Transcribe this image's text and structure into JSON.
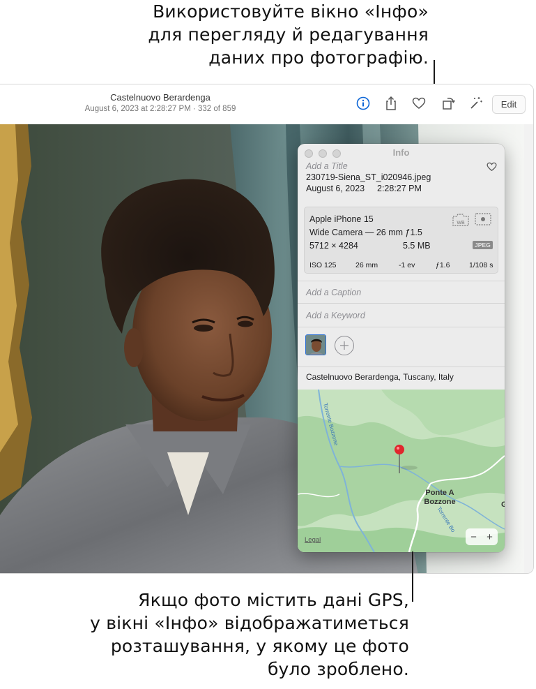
{
  "callouts": {
    "top": [
      "Використовуйте вікно «Інфо»",
      "для перегляду й редагування",
      "даних про фотографію."
    ],
    "bottom": [
      "Якщо фото містить дані GPS,",
      "у вікні «Інфо» відображатиметься",
      "розташування, у якому це фото",
      "було зроблено."
    ]
  },
  "toolbar": {
    "place": "Castelnuovo Berardenga",
    "meta": "August 6, 2023 at 2:28:27 PM  ·  332 of 859",
    "edit_label": "Edit",
    "icons": [
      "info-icon",
      "share-icon",
      "heart-icon",
      "rotate-icon",
      "magic-wand-icon"
    ]
  },
  "info": {
    "window_title": "Info",
    "title_placeholder": "Add a Title",
    "filename": "230719-Siena_ST_i020946.jpeg",
    "date": "August 6, 2023",
    "time": "2:28:27 PM",
    "camera": {
      "model": "Apple iPhone 15",
      "lens": "Wide Camera — 26 mm ƒ1.5",
      "dimensions": "5712 × 4284",
      "size": "5.5 MB",
      "format": "JPEG",
      "exif": [
        "ISO 125",
        "26 mm",
        "-1 ev",
        "ƒ1.6",
        "1/108 s"
      ]
    },
    "caption_placeholder": "Add a Caption",
    "keyword_placeholder": "Add a Keyword",
    "location": "Castelnuovo Berardenga, Tuscany, Italy",
    "map": {
      "place_label_1": "Ponte A",
      "place_label_2": "Bozzone",
      "road_1": "Torrente Bozzone",
      "road_2": "Torrente Bo",
      "edge_label": "G",
      "legal": "Legal",
      "zoom_out": "−",
      "zoom_in": "+"
    }
  },
  "colors": {
    "accent": "#0a64d6",
    "pin": "#e0262d"
  }
}
